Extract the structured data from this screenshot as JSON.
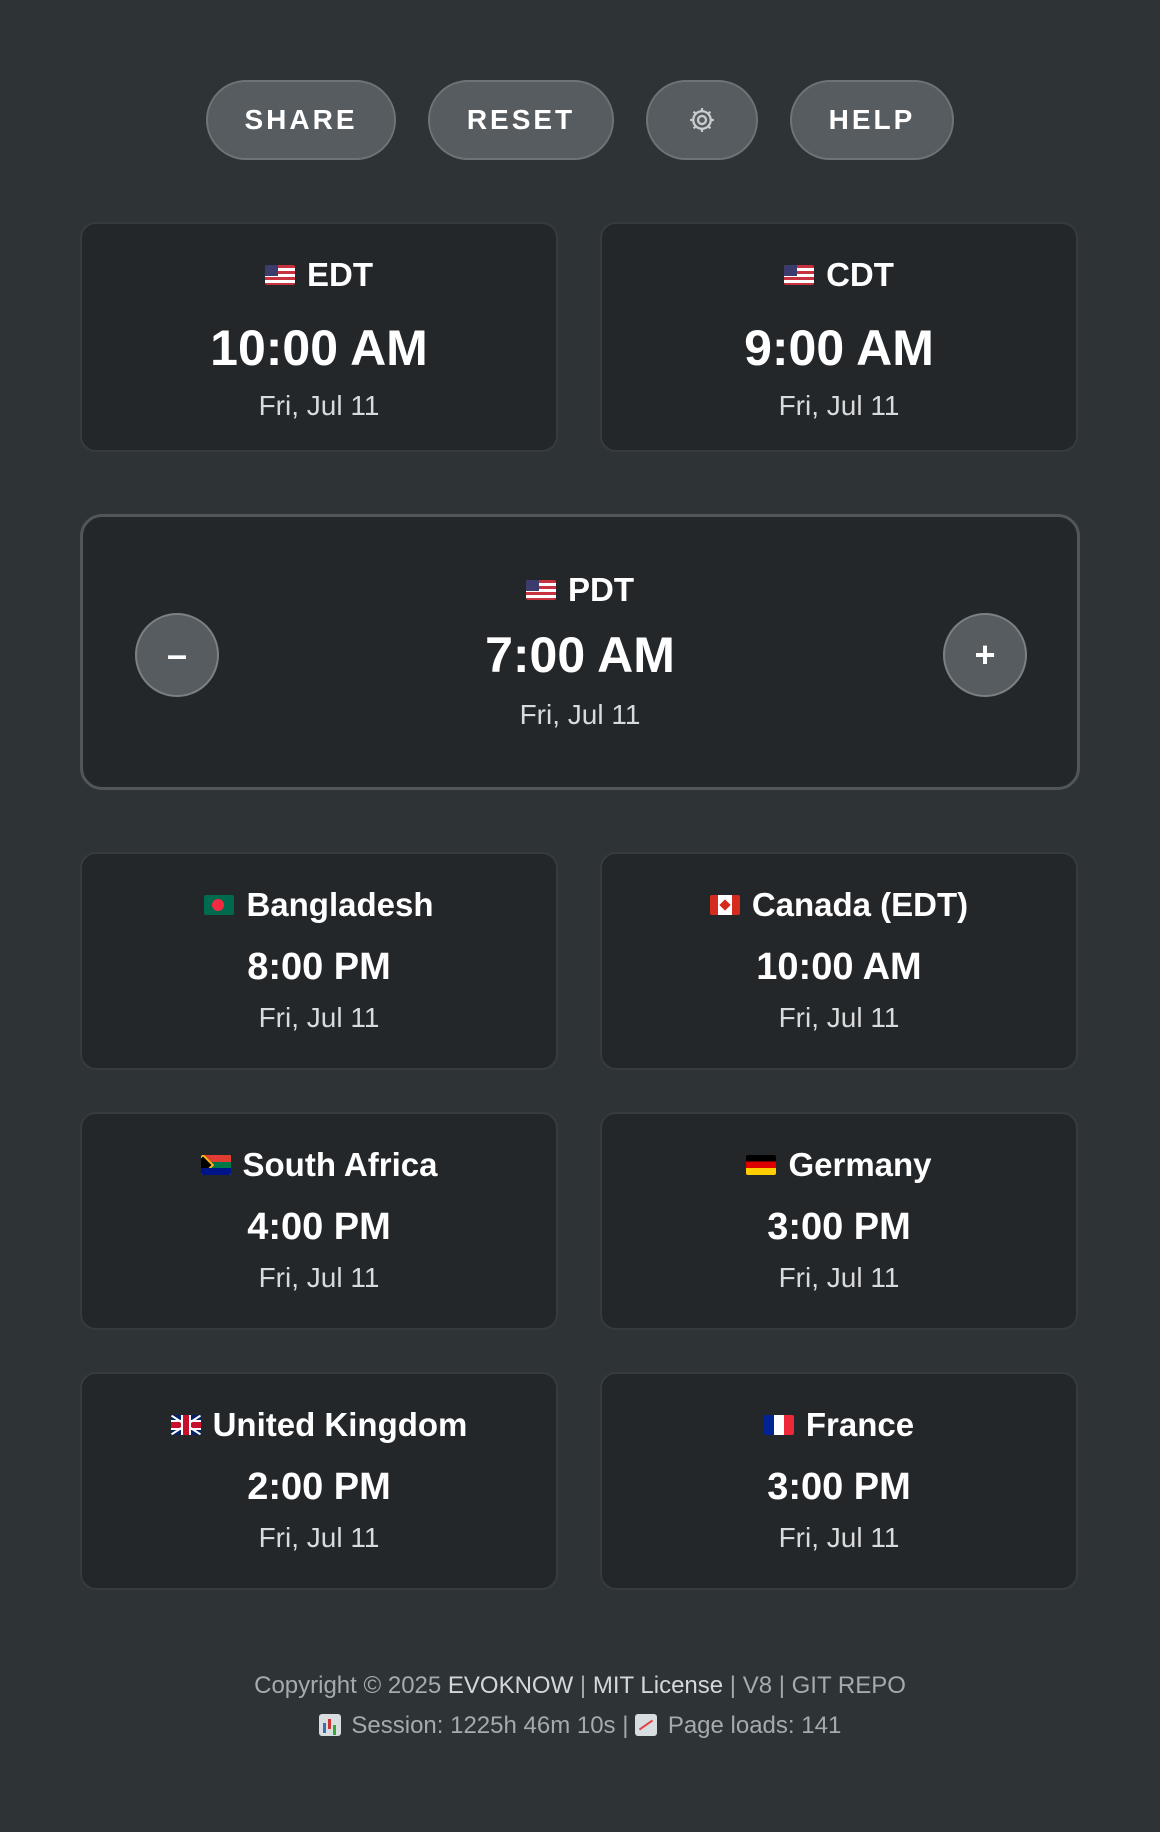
{
  "toolbar": {
    "share_label": "SHARE",
    "reset_label": "RESET",
    "settings_icon": "gear-icon",
    "help_label": "HELP"
  },
  "top_zones": [
    {
      "label": "EDT",
      "flag": "us-flag-icon",
      "time": "10:00 AM",
      "date": "Fri, Jul 11"
    },
    {
      "label": "CDT",
      "flag": "us-flag-icon",
      "time": "9:00 AM",
      "date": "Fri, Jul 11"
    }
  ],
  "main_zone": {
    "label": "PDT",
    "flag": "us-flag-icon",
    "time": "7:00 AM",
    "date": "Fri, Jul 11",
    "decrement_label": "–",
    "increment_label": "+"
  },
  "countries": [
    {
      "label": "Bangladesh",
      "flag": "bangladesh-flag-icon",
      "time": "8:00 PM",
      "date": "Fri, Jul 11"
    },
    {
      "label": "Canada (EDT)",
      "flag": "canada-flag-icon",
      "time": "10:00 AM",
      "date": "Fri, Jul 11"
    },
    {
      "label": "South Africa",
      "flag": "south-africa-flag-icon",
      "time": "4:00 PM",
      "date": "Fri, Jul 11"
    },
    {
      "label": "Germany",
      "flag": "germany-flag-icon",
      "time": "3:00 PM",
      "date": "Fri, Jul 11"
    },
    {
      "label": "United Kingdom",
      "flag": "uk-flag-icon",
      "time": "2:00 PM",
      "date": "Fri, Jul 11"
    },
    {
      "label": "France",
      "flag": "france-flag-icon",
      "time": "3:00 PM",
      "date": "Fri, Jul 11"
    }
  ],
  "footer": {
    "copyright": "Copyright © 2025",
    "brand": "EVOKNOW",
    "sep": "|",
    "license": "MIT License",
    "version": "V8",
    "repo": "GIT REPO",
    "session": "Session: 1225h 46m 10s",
    "page_loads": "Page loads: 141"
  },
  "colors": {
    "background": "#2e3336",
    "card": "#23272a",
    "pill": "#565c60"
  }
}
